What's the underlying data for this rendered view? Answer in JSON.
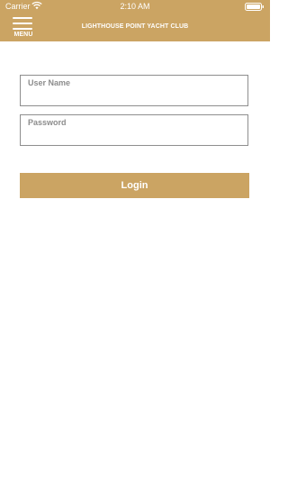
{
  "status_bar": {
    "carrier": "Carrier",
    "time": "2:10 AM"
  },
  "nav": {
    "menu_label": "MENU",
    "title": "LIGHTHOUSE POINT YACHT CLUB"
  },
  "form": {
    "username_label": "User Name",
    "username_value": "",
    "password_label": "Password",
    "password_value": "",
    "login_label": "Login"
  },
  "colors": {
    "brand": "#cba463",
    "field_border": "#8e8e8e",
    "label_text": "#8c8c8c"
  },
  "icons": [
    "wifi-icon",
    "battery-icon",
    "hamburger-menu-icon"
  ]
}
